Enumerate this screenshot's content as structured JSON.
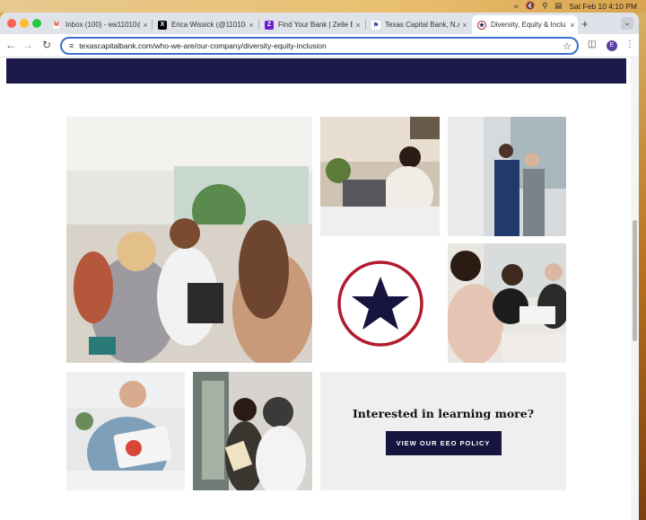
{
  "menubar": {
    "datetime": "Sat Feb 10  4:10 PM"
  },
  "tabs": [
    {
      "title": "Inbox (100) - ew11010@",
      "favicon": "gmail-icon",
      "fav_color": "#ffffff"
    },
    {
      "title": "Erica Wissick (@11010e",
      "favicon": "x-icon",
      "fav_color": "#000000"
    },
    {
      "title": "Find Your Bank | Zelle B",
      "favicon": "zelle-icon",
      "fav_color": "#6d1ed4"
    },
    {
      "title": "Texas Capital Bank, N.A",
      "favicon": "bank-icon",
      "fav_color": "#ffffff"
    },
    {
      "title": "Diversity, Equity & Inclu",
      "favicon": "star-icon",
      "fav_color": "#ffffff",
      "active": true
    }
  ],
  "address_bar": {
    "url": "texascapitalbank.com/who-we-are/our-company/diversity-equity-inclusion"
  },
  "profile": {
    "initial": "E",
    "color": "#5b3fa8"
  },
  "cta": {
    "heading": "Interested in learning more?",
    "button_label": "VIEW OUR EEO POLICY"
  },
  "colors": {
    "navy": "#1c1a4a",
    "star_red": "#b01c2e",
    "cta_bg": "#efefef"
  }
}
